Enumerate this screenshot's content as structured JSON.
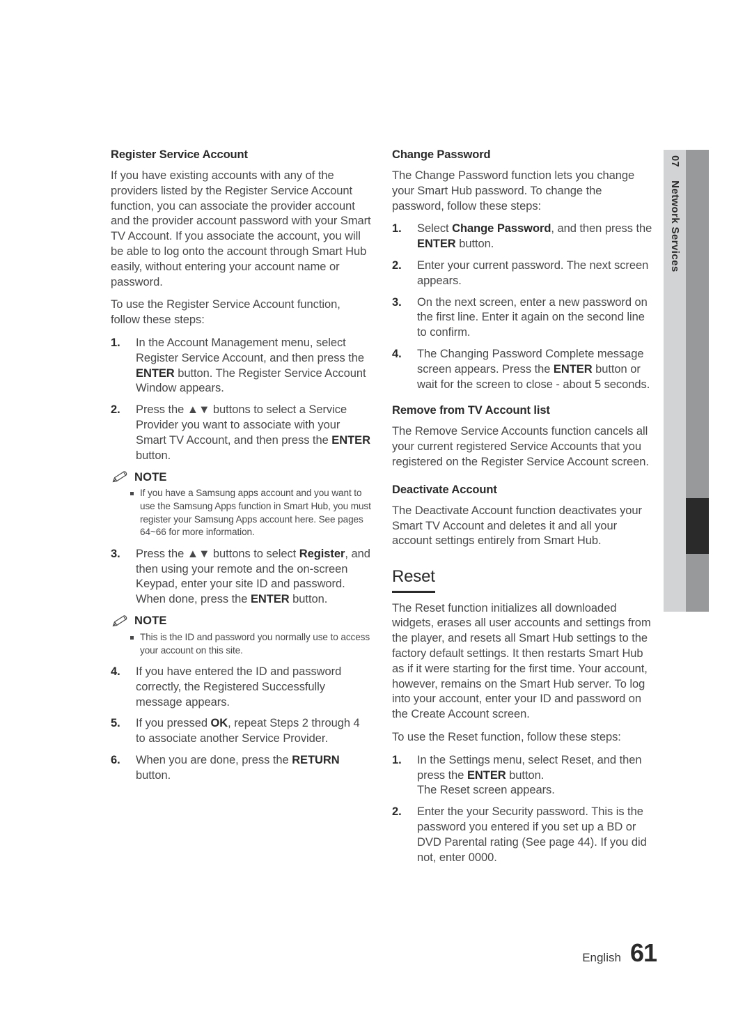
{
  "side_tab": {
    "chapter_number": "07",
    "chapter_title": "Network Services",
    "light_band_color": "#d2d3d5",
    "dark_band_color": "#97999b",
    "marker_color": "#2b2a2a"
  },
  "left_column": {
    "heading": "Register Service Account",
    "intro_paragraph_1": "If you have existing accounts with any of the providers listed by the Register Service Account function, you can associate the provider account and the provider account password with your Smart TV Account. If you associate the account, you will be able to log onto the account through Smart Hub easily, without entering your account name or password.",
    "intro_paragraph_2": "To use the Register Service Account function, follow these steps:",
    "step1_num": "1.",
    "step1_a": "In the Account Management menu, select Register Service Account, and then press the ",
    "step1_b": "ENTER",
    "step1_c": " button. The Register Service Account Window appears.",
    "step2_num": "2.",
    "step2_a": "Press the ",
    "step2_arrows": "▲▼",
    "step2_b": " buttons to select a Service Provider you want to associate with your Smart TV Account, and then press the ",
    "step2_c": "ENTER",
    "step2_d": " button.",
    "note1_label": "NOTE",
    "note1_item": "If you have a Samsung apps account and you want to use the Samsung Apps function in Smart Hub, you must register your Samsung Apps account here. See pages 64~66 for more information.",
    "step3_num": "3.",
    "step3_a": "Press the ",
    "step3_arrows": "▲▼",
    "step3_b": " buttons to select ",
    "step3_c": "Register",
    "step3_d": ", and then using your remote and the on-screen Keypad, enter your site ID and password. When done, press the ",
    "step3_e": "ENTER",
    "step3_f": " button.",
    "note2_label": "NOTE",
    "note2_item": "This is the ID and password you normally use to access your account on this site.",
    "step4_num": "4.",
    "step4_a": "If you have entered the ID and password correctly, the Registered Successfully message appears.",
    "step5_num": "5.",
    "step5_a": "If you pressed ",
    "step5_b": "OK",
    "step5_c": ", repeat Steps 2 through 4 to associate another Service Provider.",
    "step6_num": "6.",
    "step6_a": "When you are done, press the ",
    "step6_b": "RETURN",
    "step6_c": " button."
  },
  "right_column": {
    "change_password": {
      "heading": "Change Password",
      "paragraph": "The Change Password function lets you change your Smart Hub password. To change the password, follow these steps:",
      "step1_num": "1.",
      "step1_a": "Select ",
      "step1_b": "Change Password",
      "step1_c": ", and then press the ",
      "step1_d": "ENTER",
      "step1_e": " button.",
      "step2_num": "2.",
      "step2_a": "Enter your current password. The next screen appears.",
      "step3_num": "3.",
      "step3_a": "On the next screen, enter a new password on the first line. Enter it again on the second line to confirm.",
      "step4_num": "4.",
      "step4_a": "The Changing Password Complete message screen appears. Press the ",
      "step4_b": "ENTER",
      "step4_c": " button or wait for the screen to close - about 5 seconds."
    },
    "remove_from_tv": {
      "heading": "Remove from TV Account list",
      "paragraph": "The Remove Service Accounts function cancels all your current registered Service Accounts that you registered on the Register Service Account screen."
    },
    "deactivate_account": {
      "heading": "Deactivate Account",
      "paragraph": "The Deactivate Account function deactivates your Smart TV Account and deletes it and all your account settings entirely from Smart Hub."
    },
    "reset": {
      "heading": "Reset",
      "paragraph_1": "The Reset function initializes all downloaded widgets, erases all user accounts and settings from the player, and resets all Smart Hub settings to the factory default settings. It then restarts Smart Hub as if it were starting for the first time. Your account, however, remains on the Smart Hub server. To log into your account, enter your ID and password on the Create Account screen.",
      "paragraph_2": "To use the Reset function, follow these steps:",
      "step1_num": "1.",
      "step1_a": "In the Settings menu, select Reset, and then press the ",
      "step1_b": "ENTER",
      "step1_c": " button.",
      "step1_d": "The Reset screen appears.",
      "step2_num": "2.",
      "step2_a": "Enter the your Security password. This is the password you entered if you set up a BD or DVD Parental rating (See page 44). If you did not, enter 0000."
    }
  },
  "footer": {
    "language": "English",
    "page_number": "61"
  }
}
